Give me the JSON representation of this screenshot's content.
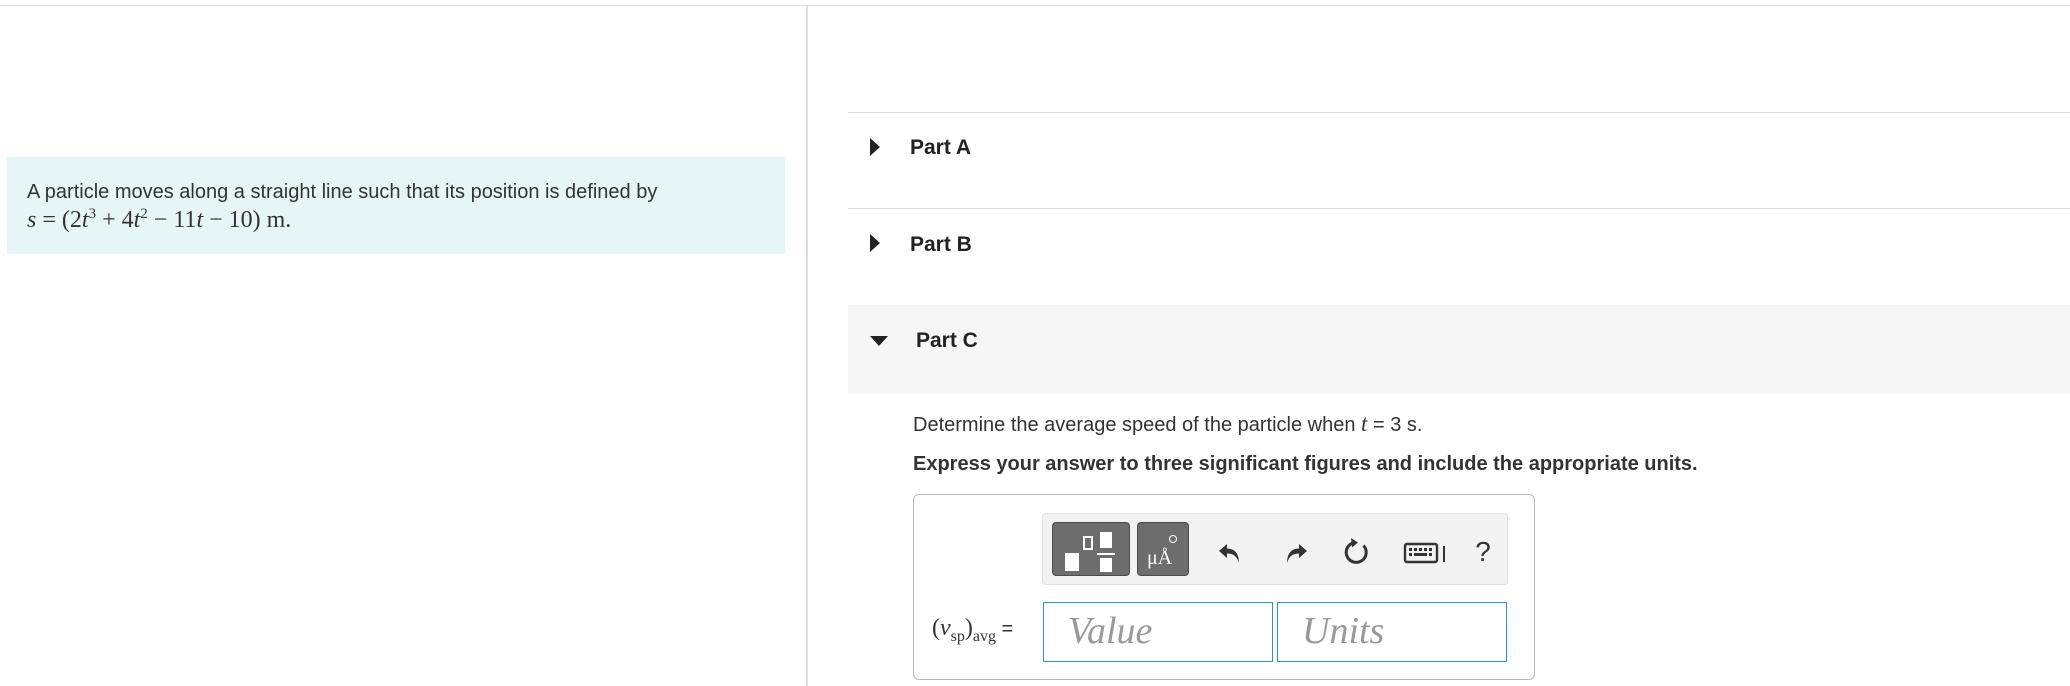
{
  "problem": {
    "text": "A particle moves along a straight line such that its position is defined by",
    "equation": {
      "lhs": "s",
      "equals": "=",
      "open": "(2",
      "t1": "t",
      "exp1": "3",
      "term2": " + 4",
      "t2": "t",
      "exp2": "2",
      "term3": " − 11",
      "t3": "t",
      "term4": " − 10) m."
    }
  },
  "parts": [
    {
      "label": "Part A",
      "state": "collapsed"
    },
    {
      "label": "Part B",
      "state": "collapsed"
    },
    {
      "label": "Part C",
      "state": "expanded"
    }
  ],
  "partC": {
    "question_pre": "Determine the average speed of the particle when ",
    "question_var": "t",
    "question_post": " = 3 s.",
    "instruction": "Express your answer to three significant figures and include the appropriate units.",
    "answer": {
      "label_open": "(",
      "label_var": "v",
      "label_sub": "sp",
      "label_close": ")",
      "label_sub2": "avg",
      "label_eq": " =",
      "value_placeholder": "Value",
      "units_placeholder": "Units",
      "value": "",
      "units": ""
    },
    "toolbar": {
      "templates_icon": "templates-icon",
      "units_icon": "units-icon",
      "units_glyph": "μÅ",
      "undo_icon": "undo-icon",
      "redo_icon": "redo-icon",
      "reset_icon": "reset-icon",
      "keyboard_icon": "keyboard-icon",
      "help_label": "?"
    }
  },
  "colors": {
    "problem_bg": "#e6f6f6",
    "field_border": "#2a9aa3",
    "toolbar_button": "#6d6d6d"
  }
}
